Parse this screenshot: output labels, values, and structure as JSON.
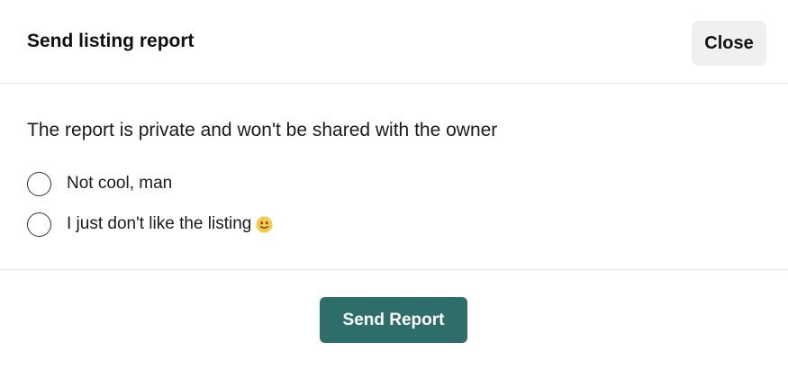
{
  "dialog": {
    "title": "Send listing report",
    "close_label": "Close"
  },
  "body": {
    "notice": "The report is private and won't be shared with the owner",
    "options": [
      {
        "label": "Not cool, man",
        "selected": false
      },
      {
        "label": "I just don't like the listing",
        "selected": false,
        "icon": "slightly-smiling-face-emoji"
      }
    ]
  },
  "footer": {
    "submit_label": "Send Report"
  },
  "colors": {
    "submit_background": "#2d6e6a",
    "close_background": "#f0f0f0",
    "divider": "#e6e6e6",
    "emoji_yellow": "#f7c948"
  }
}
